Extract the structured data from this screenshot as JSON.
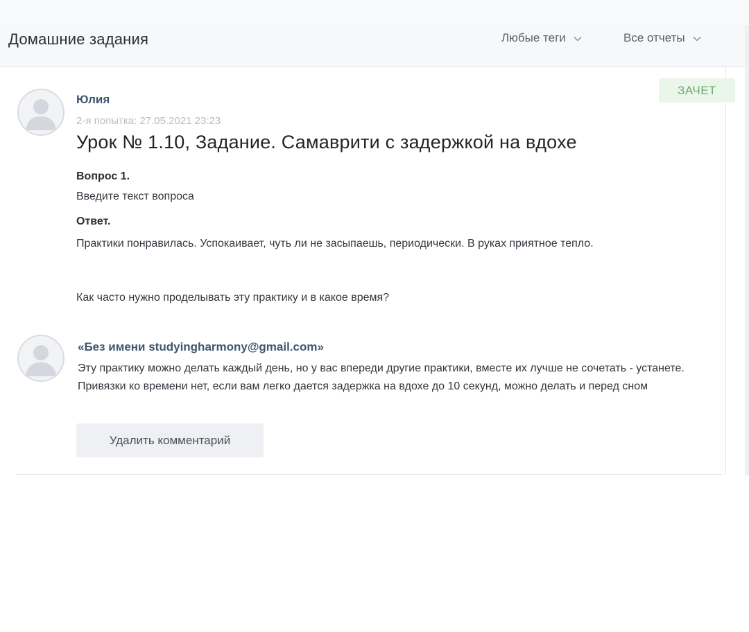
{
  "header": {
    "title": "Домашние задания",
    "filters": [
      {
        "label": "Любые теги",
        "icon": "chevron-down-icon"
      },
      {
        "label": "Все отчеты",
        "icon": "chevron-down-icon"
      }
    ]
  },
  "report": {
    "author": "Юлия",
    "attempt": "2-я попытка: 27.05.2021 23:23",
    "status_badge": "ЗАЧЕТ",
    "lesson_title": "Урок № 1.10, Задание. Самаврити с задержкой на вдохе",
    "question_label": "Вопрос 1.",
    "question_text": "Введите текст вопроса",
    "answer_label": "Ответ.",
    "answer_text": "Практики понравилась. Успокаивает, чуть ли не засыпаешь, периодически. В руках приятное тепло.",
    "answer_followup": "Как часто нужно проделывать эту практику и в какое время?"
  },
  "comment": {
    "author": "«Без имени studyingharmony@gmail.com»",
    "text": "Эту практику можно делать каждый день, но у вас впереди другие практики, вместе их лучше не сочетать - устанете. Привязки ко времени нет, если вам легко дается задержка на вдохе до 10 секунд, можно делать и перед сном",
    "delete_label": "Удалить комментарий"
  },
  "colors": {
    "badge_bg": "#eaf6ea",
    "badge_text": "#6aaa6c",
    "author_link": "#3e5670"
  }
}
